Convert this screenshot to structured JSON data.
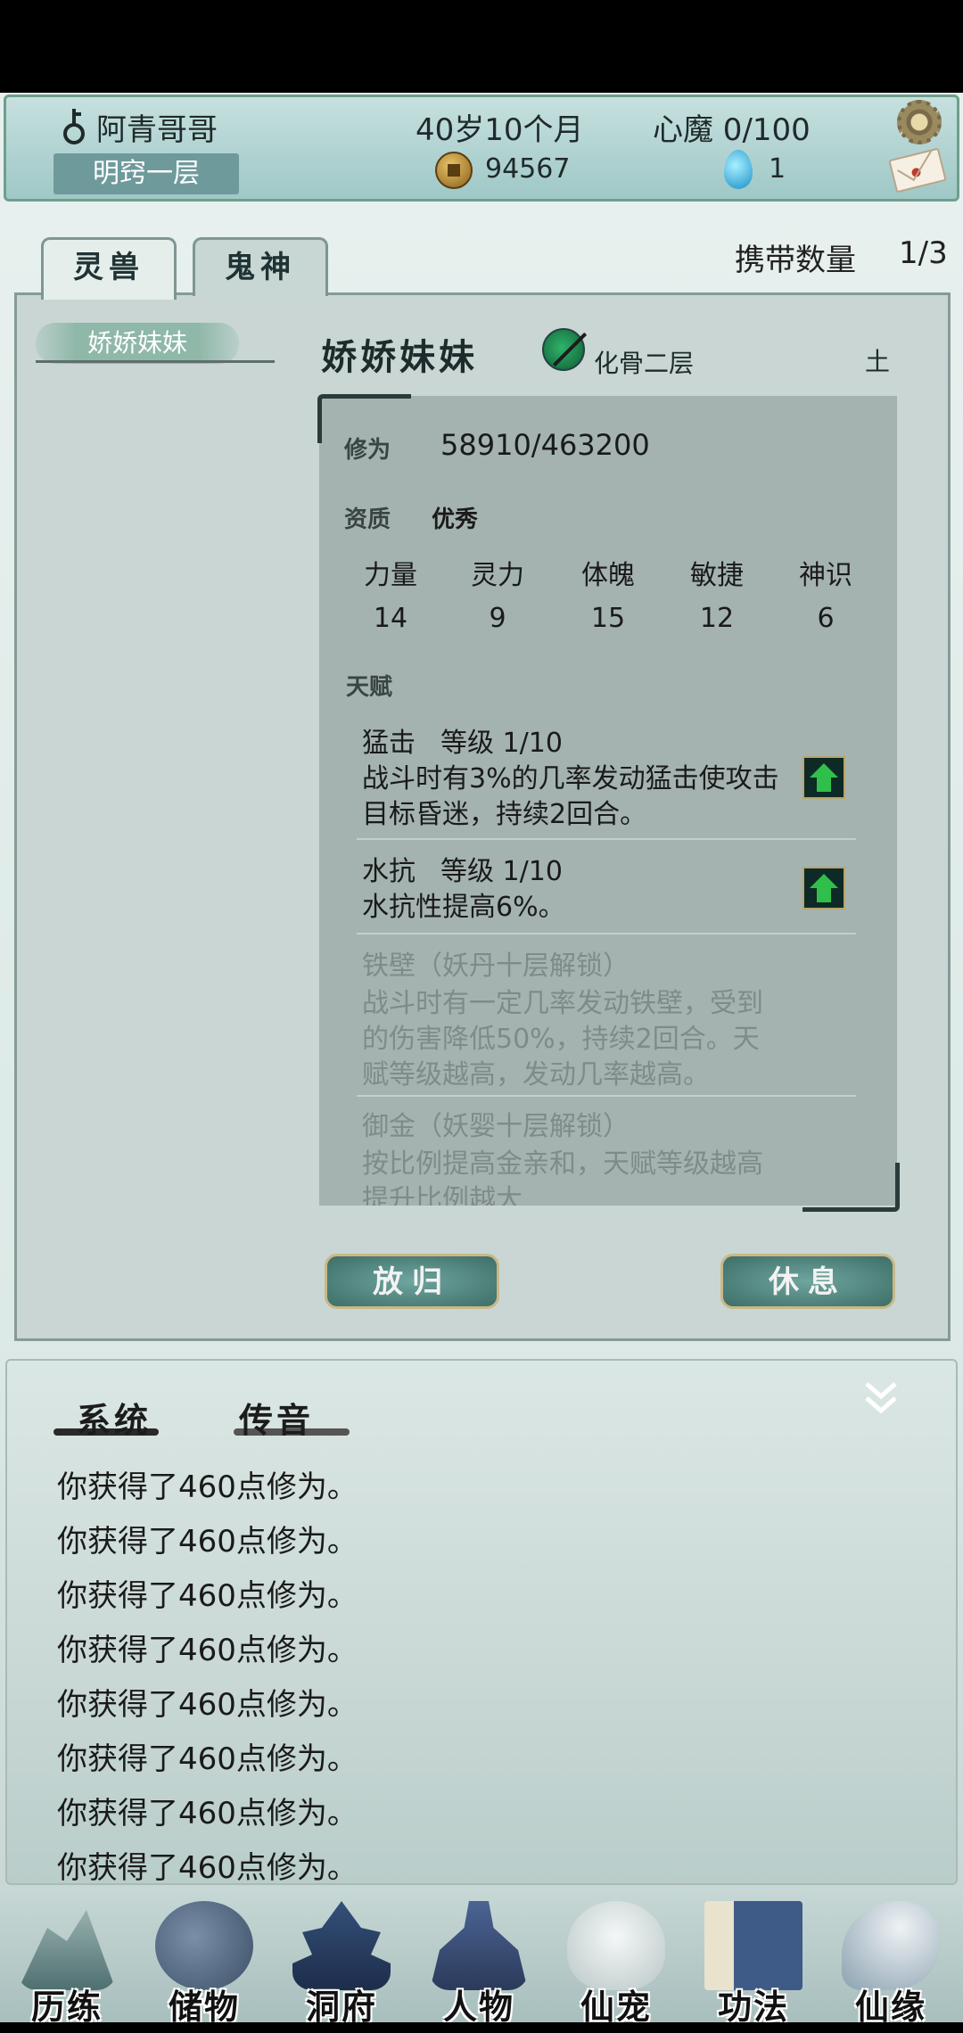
{
  "header": {
    "player_name": "阿青哥哥",
    "realm": "明窍一层",
    "age": "40岁10个月",
    "heart_demon": "心魔  0/100",
    "coins": "94567",
    "spirit_stones": "1"
  },
  "tabs": [
    {
      "label": "灵兽",
      "active": true
    },
    {
      "label": "鬼神",
      "active": false
    }
  ],
  "carry": {
    "label": "携带数量",
    "value": "1/3"
  },
  "pet_list": [
    "娇娇妹妹"
  ],
  "pet": {
    "name": "娇娇妹妹",
    "level": "化骨二层",
    "element": "土",
    "cultivation_label": "修为",
    "cultivation_value": "58910/463200",
    "aptitude_label": "资质",
    "aptitude_value": "优秀",
    "stats": {
      "headers": [
        "力量",
        "灵力",
        "体魄",
        "敏捷",
        "神识"
      ],
      "values": [
        "14",
        "9",
        "15",
        "12",
        "6"
      ]
    },
    "talents_label": "天赋",
    "talents": [
      {
        "name": "猛击",
        "level": "等级  1/10",
        "desc": "战斗时有3%的几率发动猛击使攻击目标昏迷，持续2回合。",
        "locked": false
      },
      {
        "name": "水抗",
        "level": "等级  1/10",
        "desc": "水抗性提高6%。",
        "locked": false
      },
      {
        "name": "铁壁（妖丹十层解锁）",
        "desc": "战斗时有一定几率发动铁壁，受到的伤害降低50%，持续2回合。天赋等级越高，发动几率越高。",
        "locked": true
      },
      {
        "name": "御金（妖婴十层解锁）",
        "desc": "按比例提高金亲和，天赋等级越高提升比例越大",
        "locked": true
      }
    ]
  },
  "actions": {
    "release": "放归",
    "rest": "休息"
  },
  "log": {
    "tabs": [
      "系统",
      "传音"
    ],
    "lines": [
      "你获得了460点修为。",
      "你获得了460点修为。",
      "你获得了460点修为。",
      "你获得了460点修为。",
      "你获得了460点修为。",
      "你获得了460点修为。",
      "你获得了460点修为。",
      "你获得了460点修为。"
    ]
  },
  "nav": [
    {
      "label": "历练",
      "icon": "mountain-icon"
    },
    {
      "label": "储物",
      "icon": "gourd-bag-icon"
    },
    {
      "label": "洞府",
      "icon": "pagoda-icon"
    },
    {
      "label": "人物",
      "icon": "character-icon"
    },
    {
      "label": "仙宠",
      "icon": "ghost-pet-icon"
    },
    {
      "label": "功法",
      "icon": "book-icon"
    },
    {
      "label": "仙缘",
      "icon": "crane-icon"
    }
  ]
}
